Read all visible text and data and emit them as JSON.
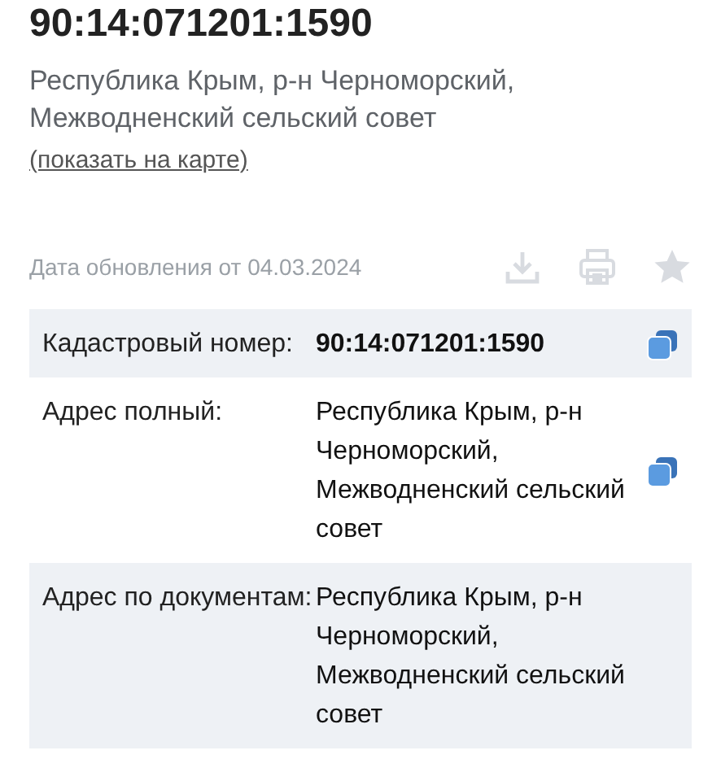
{
  "header": {
    "title": "90:14:071201:1590",
    "address": "Республика Крым, р-н Черноморский, Межводненский сельский совет",
    "map_link": "(показать на карте)"
  },
  "update_date": "Дата обновления от 04.03.2024",
  "rows": [
    {
      "label": "Кадастровый номер:",
      "value": "90:14:071201:1590",
      "copyable": true
    },
    {
      "label": "Адрес полный:",
      "value": "Республика Крым, р-н Черноморский, Межводненский сельский совет",
      "copyable": true
    },
    {
      "label": "Адрес по документам:",
      "value": "Республика Крым, р-н Черноморский, Межводненский сельский совет",
      "copyable": false
    }
  ]
}
